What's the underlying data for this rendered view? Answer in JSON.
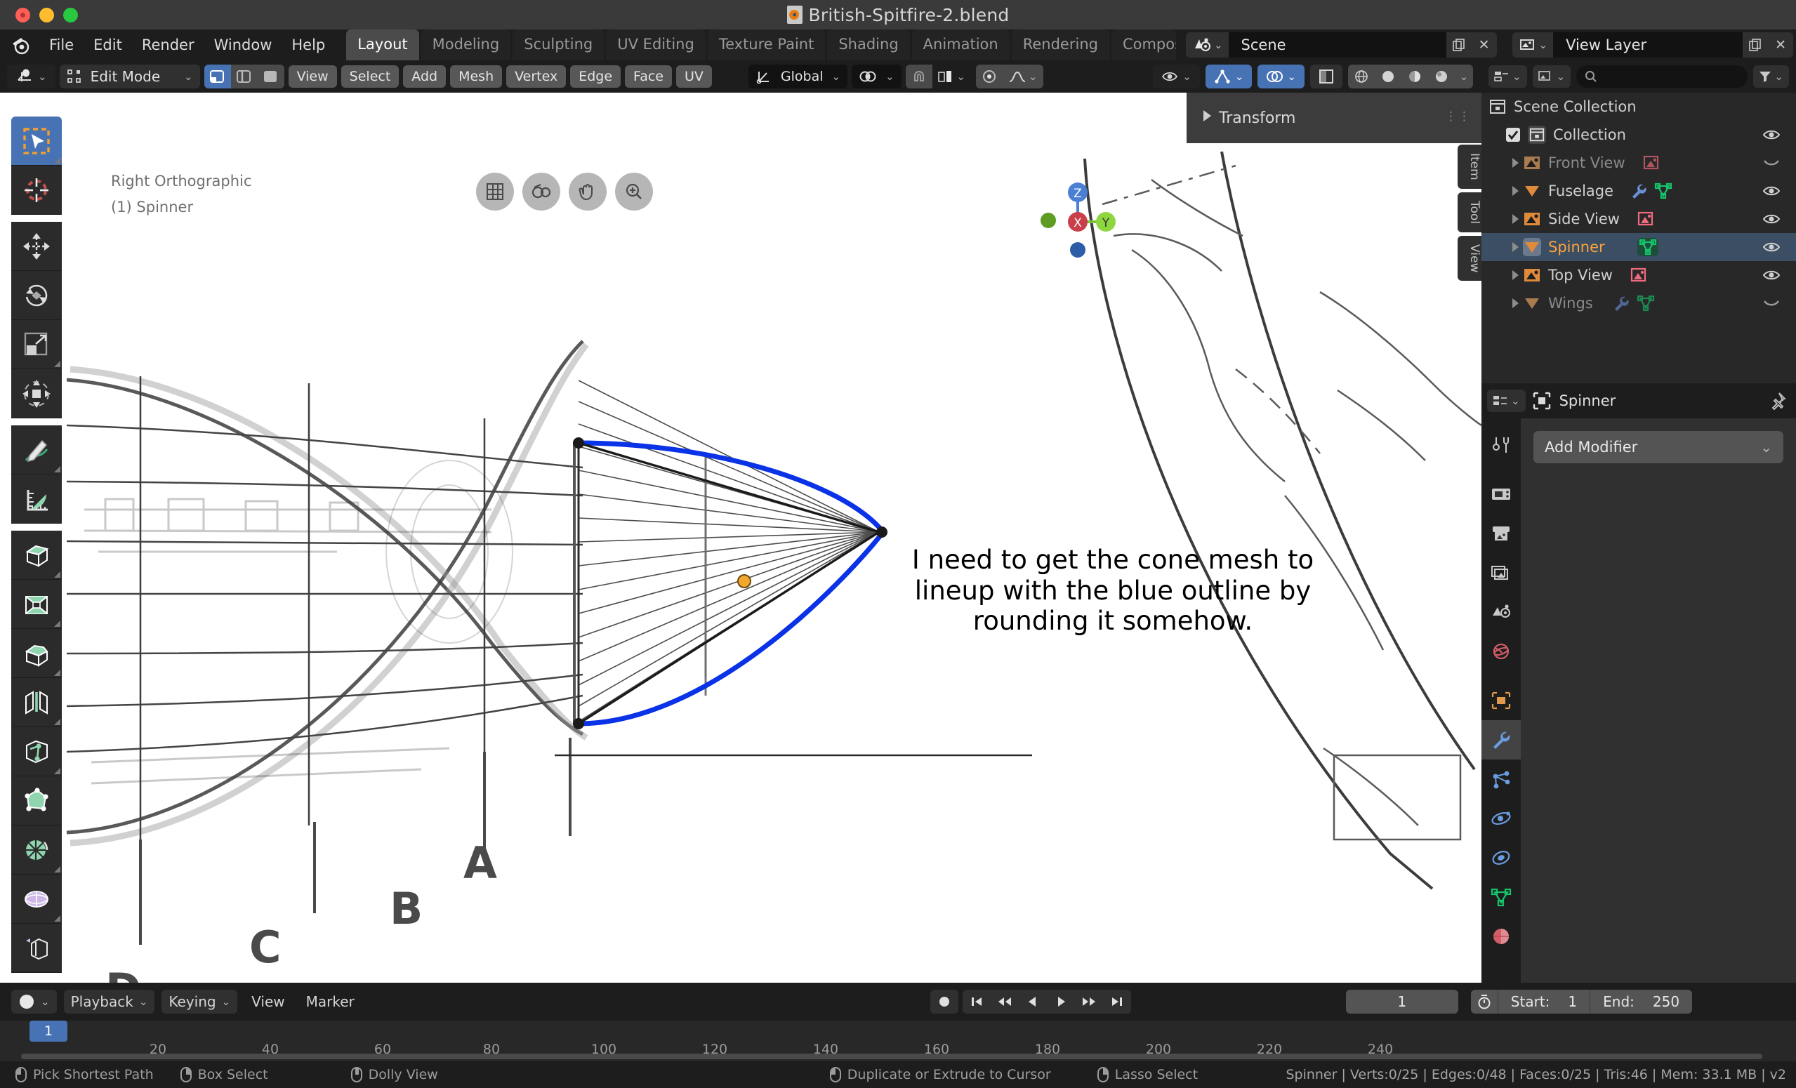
{
  "window": {
    "title": "British-Spitfire-2.blend",
    "traffic_lights": [
      "close",
      "minimize",
      "maximize"
    ]
  },
  "topbar": {
    "app_menus": [
      "File",
      "Edit",
      "Render",
      "Window",
      "Help"
    ],
    "workspace_tabs": [
      {
        "label": "Layout",
        "active": true
      },
      {
        "label": "Modeling",
        "active": false
      },
      {
        "label": "Sculpting",
        "active": false
      },
      {
        "label": "UV Editing",
        "active": false
      },
      {
        "label": "Texture Paint",
        "active": false
      },
      {
        "label": "Shading",
        "active": false
      },
      {
        "label": "Animation",
        "active": false
      },
      {
        "label": "Rendering",
        "active": false
      },
      {
        "label": "Compos",
        "active": false
      }
    ],
    "scene_name": "Scene",
    "view_layer_name": "View Layer"
  },
  "viewport": {
    "header": {
      "editor_type": "editor-type-icon",
      "mode": "Edit Mode",
      "select_modes": [
        "vertex",
        "edge",
        "face"
      ],
      "active_select_mode": "vertex",
      "menus": [
        "View",
        "Select",
        "Add",
        "Mesh",
        "Vertex",
        "Edge",
        "Face",
        "UV"
      ],
      "transform_orientation": "Global",
      "snap_label": "snap-magnet",
      "proportional_label": "proportional-editing"
    },
    "overlay_view_name": "Right Orthographic",
    "overlay_object_name": "(1) Spinner",
    "annotation_text": "I need to get the cone mesh to lineup with the blue outline by rounding it somehow.",
    "axis_gizmo": {
      "z": "Z",
      "x": "X",
      "y": "Y"
    },
    "blueprint_labels": [
      "A",
      "B",
      "C",
      "D"
    ],
    "outline_color": "#0a32e6",
    "active_tool": "select-box"
  },
  "toolbar": {
    "tools": [
      {
        "name": "select-box",
        "active": true
      },
      {
        "name": "cursor",
        "active": false
      },
      {
        "name": "move",
        "active": false
      },
      {
        "name": "rotate",
        "active": false
      },
      {
        "name": "scale",
        "active": false
      },
      {
        "name": "transform",
        "active": false
      },
      {
        "name": "annotate",
        "active": false
      },
      {
        "name": "measure",
        "active": false
      },
      {
        "name": "extrude-region",
        "active": false
      },
      {
        "name": "inset-faces",
        "active": false
      },
      {
        "name": "bevel",
        "active": false
      },
      {
        "name": "loop-cut",
        "active": false
      },
      {
        "name": "knife",
        "active": false
      },
      {
        "name": "poly-build",
        "active": false
      },
      {
        "name": "spin",
        "active": false
      },
      {
        "name": "smooth",
        "active": false
      },
      {
        "name": "shrink-fatten",
        "active": false
      }
    ]
  },
  "side_panel": {
    "header": "Transform",
    "tabs": [
      "Item",
      "Tool",
      "View"
    ]
  },
  "outliner": {
    "search_placeholder": "",
    "rows": [
      {
        "label": "Scene Collection",
        "type": "scene-collection",
        "indent": 0,
        "selected": false,
        "dimmed": false,
        "visible": null,
        "checkbox": false,
        "disclosure": false,
        "icons": []
      },
      {
        "label": "Collection",
        "type": "collection",
        "indent": 1,
        "selected": false,
        "dimmed": false,
        "visible": true,
        "checkbox": true,
        "disclosure": false,
        "icons": []
      },
      {
        "label": "Front View",
        "type": "empty-image",
        "indent": 2,
        "selected": false,
        "dimmed": true,
        "visible": false,
        "checkbox": false,
        "disclosure": true,
        "icons": [
          "image"
        ]
      },
      {
        "label": "Fuselage",
        "type": "mesh",
        "indent": 2,
        "selected": false,
        "dimmed": false,
        "visible": true,
        "checkbox": false,
        "disclosure": true,
        "icons": [
          "modifier",
          "mesh-data"
        ]
      },
      {
        "label": "Side View",
        "type": "empty-image",
        "indent": 2,
        "selected": false,
        "dimmed": false,
        "visible": true,
        "checkbox": false,
        "disclosure": true,
        "icons": [
          "image"
        ]
      },
      {
        "label": "Spinner",
        "type": "mesh",
        "indent": 2,
        "selected": true,
        "dimmed": false,
        "visible": true,
        "checkbox": false,
        "disclosure": true,
        "icons": [
          "mesh-data"
        ]
      },
      {
        "label": "Top View",
        "type": "empty-image",
        "indent": 2,
        "selected": false,
        "dimmed": false,
        "visible": true,
        "checkbox": false,
        "disclosure": true,
        "icons": [
          "image"
        ]
      },
      {
        "label": "Wings",
        "type": "mesh",
        "indent": 2,
        "selected": false,
        "dimmed": true,
        "visible": false,
        "checkbox": false,
        "disclosure": true,
        "icons": [
          "modifier",
          "mesh-data"
        ]
      }
    ]
  },
  "properties": {
    "breadcrumb_object": "Spinner",
    "add_modifier_label": "Add Modifier",
    "tabs": [
      {
        "name": "tool",
        "active": false
      },
      {
        "name": "render",
        "active": false
      },
      {
        "name": "output",
        "active": false
      },
      {
        "name": "view-layer",
        "active": false
      },
      {
        "name": "scene",
        "active": false
      },
      {
        "name": "world",
        "active": false
      },
      {
        "name": "object",
        "active": false
      },
      {
        "name": "modifier",
        "active": true
      },
      {
        "name": "particles",
        "active": false
      },
      {
        "name": "physics",
        "active": false
      },
      {
        "name": "constraints",
        "active": false
      },
      {
        "name": "object-data",
        "active": false
      },
      {
        "name": "material",
        "active": false
      }
    ]
  },
  "timeline": {
    "menus": [
      "Playback",
      "Keying",
      "View",
      "Marker"
    ],
    "current_frame": "1",
    "start_label": "Start:",
    "start_value": "1",
    "end_label": "End:",
    "end_value": "250",
    "playhead_frame": "1",
    "ruler_ticks": [
      "20",
      "40",
      "60",
      "80",
      "100",
      "120",
      "140",
      "160",
      "180",
      "200",
      "220",
      "240"
    ]
  },
  "statusbar": {
    "hints": [
      {
        "mouse": "left",
        "label": "Pick Shortest Path"
      },
      {
        "mouse": "right",
        "label": "Box Select"
      },
      {
        "mouse": "middle",
        "label": "Dolly View"
      },
      {
        "mouse": "left",
        "label": "Duplicate or Extrude to Cursor"
      },
      {
        "mouse": "right",
        "label": "Lasso Select"
      }
    ],
    "scene_stats": "Spinner | Verts:0/25 | Edges:0/48 | Faces:0/25 | Tris:46 | Mem: 33.1 MB | v2"
  },
  "colors": {
    "accent_blue": "#4772b3",
    "selected_orange": "#ffa338",
    "outline_blue": "#0a32e6",
    "mesh_green": "#15c46a",
    "empty_orange": "#e08a3c"
  }
}
